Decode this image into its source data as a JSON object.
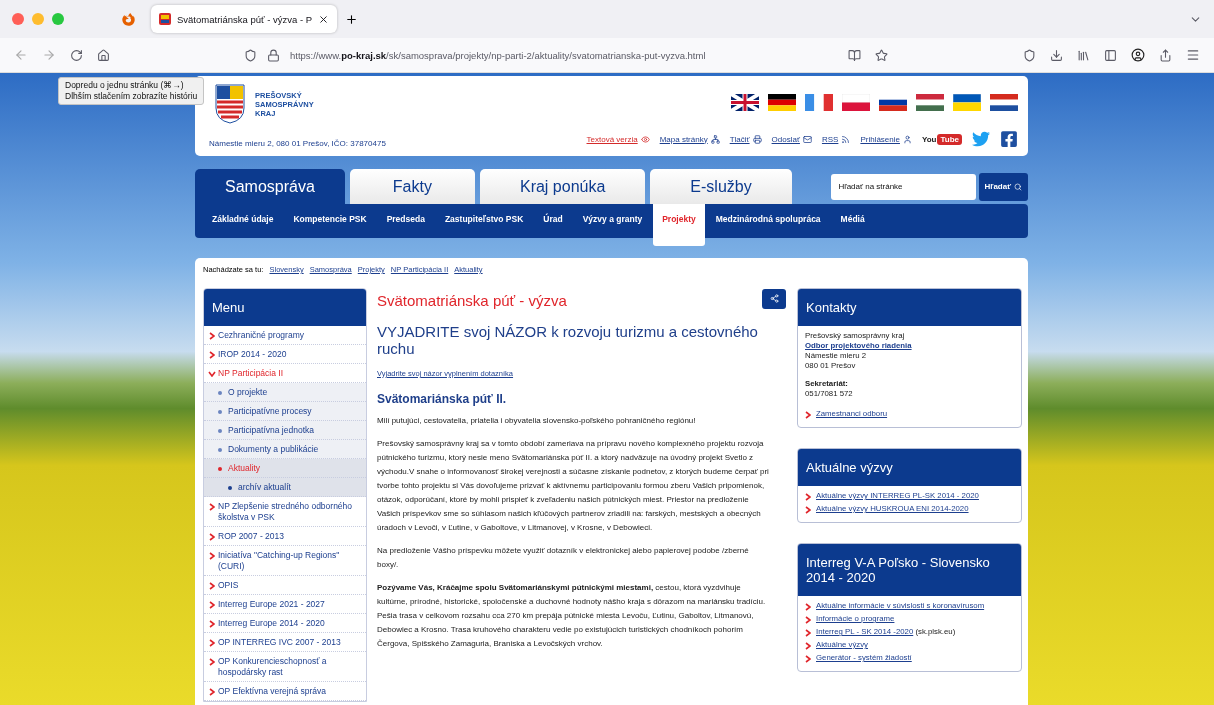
{
  "browser": {
    "tabs": [
      {
        "title": "Svätomatriánska púť - výzva - P",
        "selected": true
      }
    ],
    "url": "https://www.**po-kraj.sk**/sk/samosprava/projekty/np-parti-2/aktuality/svatomatrianska-put-vyzva.html",
    "tooltip": [
      "Dopredu o jednu stránku (⌘→)",
      "Dlhším stlačením zobrazíte históriu"
    ]
  },
  "header": {
    "logo_lines": [
      "PREŠOVSKÝ",
      "SAMOSPRÁVNY",
      "KRAJ"
    ],
    "address": "Námestie mieru 2, 080 01 Prešov, IČO: 37870475",
    "links": [
      {
        "label": "Textová verzia",
        "kind": "eye",
        "highlighted": true
      },
      {
        "label": "Mapa stránky",
        "kind": "sitemap",
        "highlighted": false
      },
      {
        "label": "Tlačiť",
        "kind": "print",
        "highlighted": false
      },
      {
        "label": "Odoslať",
        "kind": "mail",
        "highlighted": false
      },
      {
        "label": "RSS",
        "kind": "rss",
        "highlighted": false
      },
      {
        "label": "Prihlásenie",
        "kind": "user",
        "highlighted": false
      }
    ],
    "youtube": [
      "You",
      "Tube"
    ]
  },
  "nav": {
    "tabs": [
      {
        "label": "Samospráva",
        "selected": true
      },
      {
        "label": "Fakty",
        "selected": false
      },
      {
        "label": "Kraj ponúka",
        "selected": false
      },
      {
        "label": "E-služby",
        "selected": false
      }
    ],
    "search": {
      "placeholder": "Hľadať na stránke",
      "button": "Hľadať"
    },
    "subnav": [
      {
        "label": "Základné údaje",
        "selected": false
      },
      {
        "label": "Kompetencie PSK",
        "selected": false
      },
      {
        "label": "Predseda",
        "selected": false
      },
      {
        "label": "Zastupiteľstvo PSK",
        "selected": false
      },
      {
        "label": "Úrad",
        "selected": false
      },
      {
        "label": "Výzvy a granty",
        "selected": false
      },
      {
        "label": "Projekty",
        "selected": true
      },
      {
        "label": "Medzinárodná spolupráca",
        "selected": false
      },
      {
        "label": "Médiá",
        "selected": false
      }
    ]
  },
  "breadcrumb": {
    "label": "Nachádzate sa tu:",
    "items": [
      "Slovensky",
      "Samospráva",
      "Projekty",
      "NP Participácia II",
      "Aktuality"
    ]
  },
  "menu": {
    "title": "Menu",
    "items": [
      {
        "label": "Cezhraničné programy",
        "expanded": false,
        "selected": false
      },
      {
        "label": "IROP 2014 - 2020",
        "expanded": false,
        "selected": false
      },
      {
        "label": "NP Participácia II",
        "expanded": true,
        "selected": false,
        "children": [
          {
            "label": "O projekte",
            "selected": false
          },
          {
            "label": "Participatívne procesy",
            "selected": false
          },
          {
            "label": "Participatívna jednotka",
            "selected": false
          },
          {
            "label": "Dokumenty a publikácie",
            "selected": false
          },
          {
            "label": "Aktuality",
            "selected": true,
            "children": [
              {
                "label": "archív aktualít",
                "selected": false
              }
            ]
          }
        ]
      },
      {
        "label": "NP Zlepšenie stredného odborného školstva v PSK",
        "expanded": false,
        "selected": false
      },
      {
        "label": "ROP 2007 - 2013",
        "expanded": false,
        "selected": false
      },
      {
        "label": "Iniciatíva \"Catching-up Regions\" (CURI)",
        "expanded": false,
        "selected": false
      },
      {
        "label": "OPIS",
        "expanded": false,
        "selected": false
      },
      {
        "label": "Interreg Europe 2021 - 2027",
        "expanded": false,
        "selected": false
      },
      {
        "label": "Interreg Europe 2014 - 2020",
        "expanded": false,
        "selected": false
      },
      {
        "label": "OP INTERREG IVC 2007 - 2013",
        "expanded": false,
        "selected": false
      },
      {
        "label": "OP Konkurencieschopnosť a hospodársky rast",
        "expanded": false,
        "selected": false
      },
      {
        "label": "OP Efektívna verejná správa",
        "expanded": false,
        "selected": false
      }
    ]
  },
  "article": {
    "title": "Svätomatriánska púť - výzva",
    "subtitle": "VYJADRITE svoj NÁZOR k rozvoju turizmu a cestovného ruchu",
    "link": "Vyjadrite svoj názor vyplnením dotazníka",
    "heading": "Svätomariánska púť II.",
    "paragraphs": [
      "Milí putujúci, cestovatelia, priatelia i obyvatelia slovensko-poľského pohraničného regiónu!",
      "Prešovský samosprávny kraj sa v tomto období zameriava na prípravu nového komplexného projektu rozvoja pútnického turizmu, ktorý nesie meno Svätomariánska púť II. a ktorý nadväzuje na úvodný projekt Svetlo z východu.V snahe o informovanosť širokej verejnosti a súčasne získanie podnetov, z ktorých budeme čerpať pri tvorbe tohto projektu si Vás dovoľujeme prizvať k aktívnemu participovaniu formou zberu Vašich pripomienok, otázok, odporúčaní, ktoré by mohli prispieť k zveľadeniu našich pútnických miest. Priestor na predloženie Vašich príspevkov sme so súhlasom našich kľúčových partnerov zriadili na: farských, mestských a obecných úradoch v Levoči, v Ľutine, v Gaboltove, v Litmanovej, v Krosne, v Debowieci.",
      "Na predloženie Vášho príspevku môžete využiť dotazník v elektronickej alebo papierovej podobe /zberné boxy/.",
      "**Pozývame Vás, Kráčajme spolu Svätomariánskymi pútnickými miestami,** cestou, ktorá vyzdvihuje kultúrne, prírodné, historické, spoločenské a duchovné hodnoty nášho kraja s dôrazom na mariánsku tradíciu. Pešia trasa v celkovom rozsahu cca 270 km prepája pútnické miesta Levoču, Ľutinu, Gaboltov, Litmanovú, Debowiec a Krosno. Trasa kruhového charakteru vedie po existujúcich turistických chodníkoch pohorím Čergova, Spišského Zamaguria, Braniska a Levočských vrchov."
    ]
  },
  "sidebar": {
    "boxes": [
      {
        "title": "Kontakty",
        "lines": [
          {
            "kind": "text",
            "text": "Prešovský samosprávny kraj"
          },
          {
            "kind": "strong-link",
            "text": "Odbor projektového riadenia"
          },
          {
            "kind": "text",
            "text": "Námestie mieru 2"
          },
          {
            "kind": "text",
            "text": "080 01 Prešov"
          },
          {
            "kind": "heading",
            "text": "Sekretariát:"
          },
          {
            "kind": "text",
            "text": "051/7081 572"
          },
          {
            "kind": "bullet-link",
            "text": "Zamestnanci odboru"
          }
        ]
      },
      {
        "title": "Aktuálne výzvy",
        "lines": [
          {
            "kind": "bullet-link",
            "text": "Aktuálne výzvy INTERREG PL-SK 2014 - 2020"
          },
          {
            "kind": "bullet-link",
            "text": "Aktuálne výzvy HUSKROUA ENI 2014-2020"
          }
        ]
      },
      {
        "title": "Interreg V-A Poľsko - Slovensko 2014 - 2020",
        "lines": [
          {
            "kind": "bullet-link",
            "text": "Aktuálne informácie v súvislosti s koronavírusom"
          },
          {
            "kind": "bullet-link",
            "text": "Informácie o programe"
          },
          {
            "kind": "bullet-link",
            "text": "Interreg PL - SK 2014 -2020",
            "suffix": "(sk.plsk.eu)"
          },
          {
            "kind": "bullet-link",
            "text": "Aktuálne výzvy"
          },
          {
            "kind": "bullet-link",
            "text": "Generátor - systém žiadostí"
          }
        ]
      }
    ]
  }
}
